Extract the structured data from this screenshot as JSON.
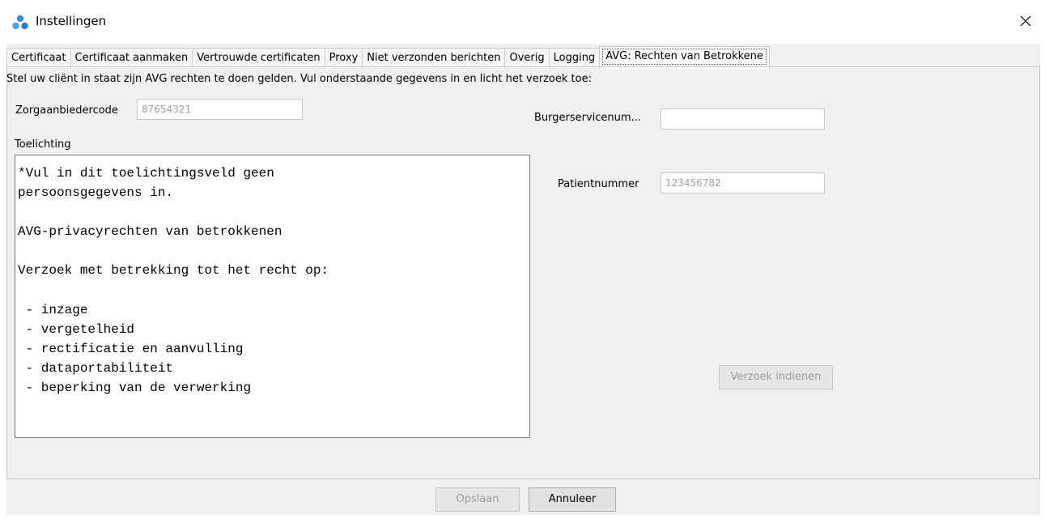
{
  "window": {
    "title": "Instellingen",
    "icon": "app-logo-icon",
    "close_icon": "close-icon"
  },
  "tabs": [
    {
      "label": "Certificaat",
      "active": false
    },
    {
      "label": "Certificaat aanmaken",
      "active": false
    },
    {
      "label": "Vertrouwde certificaten",
      "active": false
    },
    {
      "label": "Proxy",
      "active": false
    },
    {
      "label": "Niet verzonden berichten",
      "active": false
    },
    {
      "label": "Overig",
      "active": false
    },
    {
      "label": "Logging",
      "active": false
    },
    {
      "label": "AVG: Rechten van Betrokkene",
      "active": true
    }
  ],
  "form": {
    "instruction": "Stel uw cliënt in staat zijn AVG rechten te doen gelden. Vul onderstaande gegevens in en licht het verzoek toe:",
    "zorgaanbiedercode_label": "Zorgaanbiedercode",
    "zorgaanbiedercode_value": "87654321",
    "bsn_label": "Burgerservicenum...",
    "bsn_value": "",
    "patientnummer_label": "Patientnummer",
    "patientnummer_value": "123456782",
    "toelichting_label": "Toelichting",
    "toelichting_text": "*Vul in dit toelichtingsveld geen\npersoonsgegevens in.\n\nAVG-privacyrechten van betrokkenen\n\nVerzoek met betrekking tot het recht op:\n\n - inzage\n - vergetelheid\n - rectificatie en aanvulling\n - dataportabiliteit\n - beperking van de verwerking",
    "submit_label": "Verzoek indienen",
    "submit_enabled": false
  },
  "footer": {
    "save_label": "Opslaan",
    "save_enabled": false,
    "cancel_label": "Annuleer",
    "cancel_enabled": true
  },
  "colors": {
    "panel_bg": "#f0f0f0",
    "disabled_text": "#9b9b9b",
    "placeholder_text": "#a0a0a0",
    "logo_blue": "#3a8fd8"
  }
}
